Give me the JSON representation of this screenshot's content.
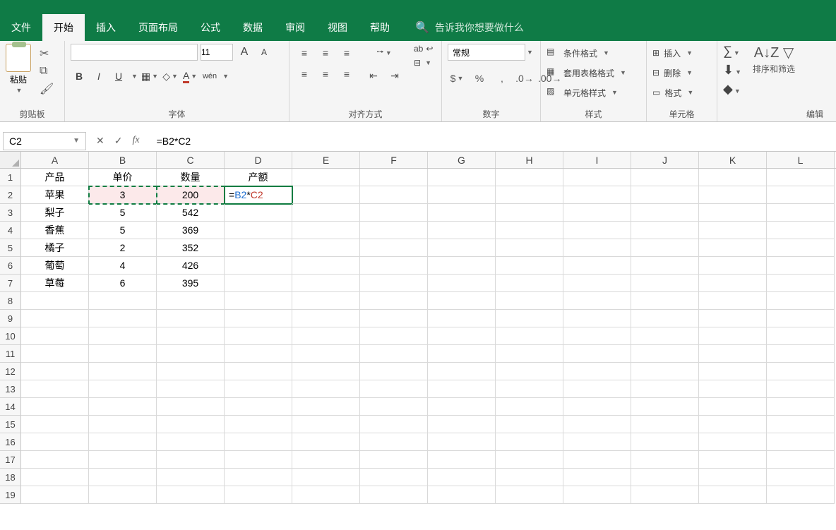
{
  "ribbon": {
    "tabs": [
      "文件",
      "开始",
      "插入",
      "页面布局",
      "公式",
      "数据",
      "审阅",
      "视图",
      "帮助"
    ],
    "active_tab_index": 1,
    "tellme_placeholder": "告诉我你想要做什么",
    "groups": {
      "clipboard": {
        "label": "剪贴板",
        "paste": "粘贴"
      },
      "font": {
        "label": "字体",
        "font_name": "",
        "font_size": "11",
        "increase": "A",
        "decrease": "A",
        "bold": "B",
        "italic": "I",
        "underline": "U",
        "phonetic": "wén"
      },
      "alignment": {
        "label": "对齐方式",
        "wrap": "ab"
      },
      "number": {
        "label": "数字",
        "format": "常规"
      },
      "styles": {
        "label": "样式",
        "conditional": "条件格式",
        "table": "套用表格格式",
        "cell": "单元格样式"
      },
      "cells": {
        "label": "单元格",
        "insert": "插入",
        "delete": "删除",
        "format": "格式"
      },
      "editing": {
        "label": "编辑",
        "sortfilter": "排序和筛选"
      }
    }
  },
  "formula_bar": {
    "name_box": "C2",
    "formula": "=B2*C2"
  },
  "grid": {
    "columns": [
      "A",
      "B",
      "C",
      "D",
      "E",
      "F",
      "G",
      "H",
      "I",
      "J",
      "K",
      "L"
    ],
    "row_count": 19,
    "headers": {
      "A": "产品",
      "B": "单价",
      "C": "数量",
      "D": "产额"
    },
    "rows": [
      {
        "A": "苹果",
        "B": "3",
        "C": "200"
      },
      {
        "A": "梨子",
        "B": "5",
        "C": "542"
      },
      {
        "A": "香蕉",
        "B": "5",
        "C": "369"
      },
      {
        "A": "橘子",
        "B": "2",
        "C": "352"
      },
      {
        "A": "葡萄",
        "B": "4",
        "C": "426"
      },
      {
        "A": "草莓",
        "B": "6",
        "C": "395"
      }
    ],
    "editing_cell": {
      "eq": "=",
      "ref1": "B2",
      "op": "*",
      "ref2": "C2"
    }
  }
}
